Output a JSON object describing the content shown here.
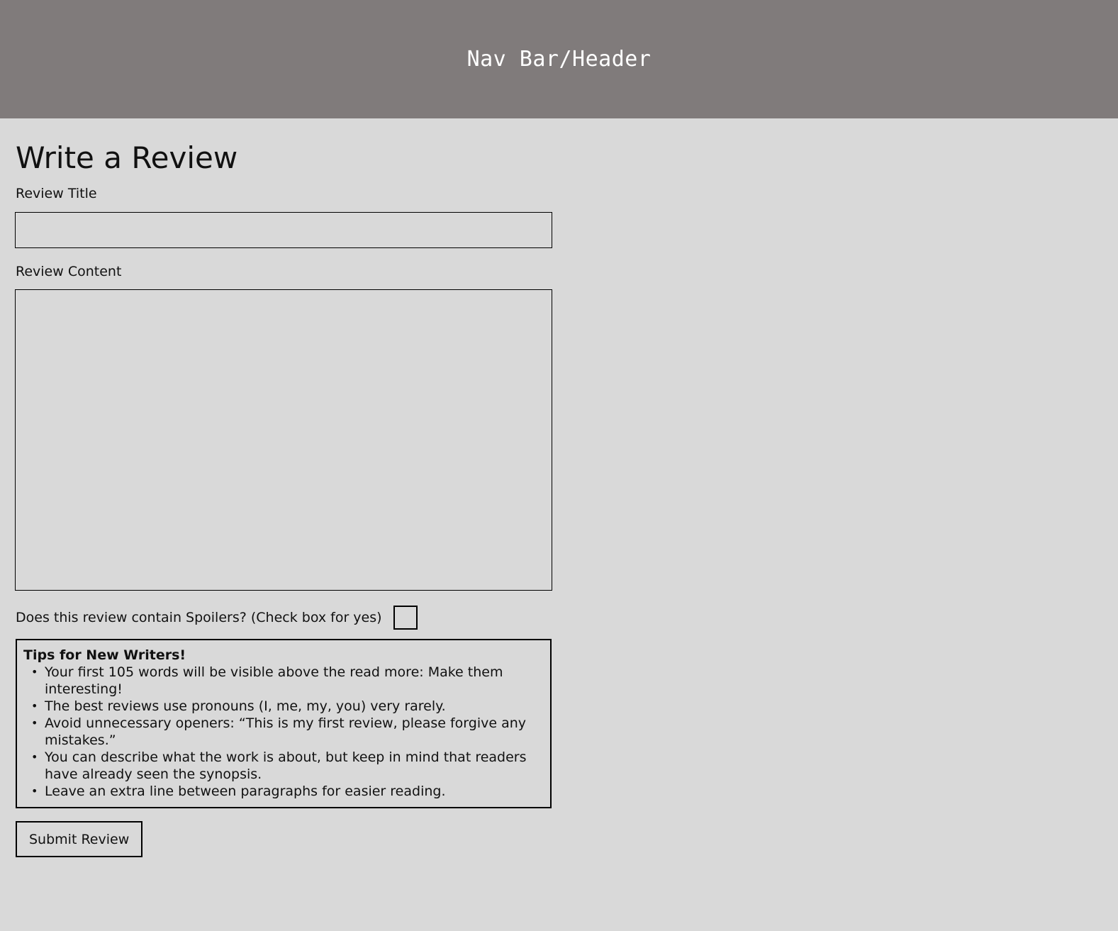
{
  "header": {
    "text": "Nav Bar/Header",
    "background_color": "#807b7b",
    "text_color": "#ffffff"
  },
  "page": {
    "background_color": "#d9d9d9",
    "title": "Write a Review"
  },
  "form": {
    "title_label": "Review Title",
    "title_value": "",
    "content_label": "Review Content",
    "content_value": "",
    "spoiler_label": "Does this review contain Spoilers? (Check box for yes)",
    "spoiler_checked": false,
    "submit_label": "Submit Review"
  },
  "tips": {
    "heading": "Tips for New Writers!",
    "items": [
      "Your first 105 words will be visible above the read more: Make them interesting!",
      "The best reviews use pronouns (I, me, my, you) very rarely.",
      "Avoid unnecessary openers: “This is my first review, please forgive any mistakes.”",
      "You can describe what the work is about, but keep in mind that readers have already seen the synopsis.",
      "Leave an extra line between paragraphs for easier reading."
    ]
  }
}
